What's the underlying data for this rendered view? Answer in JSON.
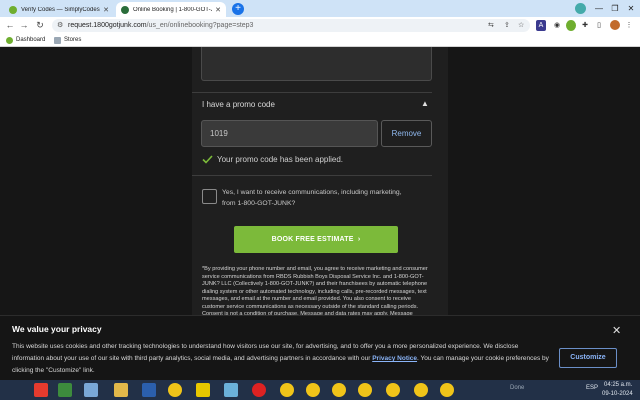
{
  "browser": {
    "tabs": [
      {
        "title": "Verify Codes — SimplyCodes",
        "active": false
      },
      {
        "title": "Online Booking | 1-800-GOT-JUN",
        "active": true
      }
    ],
    "url_host": "request.1800gotjunk.com",
    "url_path": "/us_en/onlinebooking?page=step3",
    "bookmarks": [
      {
        "label": "Dashboard"
      },
      {
        "label": "Stores"
      }
    ],
    "colors": {
      "tabbar": "#cfe3f7",
      "accent": "#1a73e8"
    }
  },
  "form": {
    "promo_heading": "I have a promo code",
    "promo_value": "1019",
    "remove_label": "Remove",
    "applied_message": "Your promo code has been applied.",
    "consent_line1": "Yes, I want to receive communications, including marketing,",
    "consent_line2": "from 1-800-GOT-JUNK?",
    "book_button": "BOOK FREE ESTIMATE",
    "fine_print": "*By providing your phone number and email, you agree to receive marketing and consumer service communications from RBDS Rubbish Boys Disposal Service Inc. and 1-800-GOT-JUNK? LLC (Collectively 1-800-GOT-JUNK?) and their franchisees by automatic telephone dialing system or other automated technology, including calls, pre-recorded messages, text messages, and email at the number and email provided. You also consent to receive customer service communications as necessary outside of the standard calling periods. Consent is not a condition of purchase. Message and data rates may apply. Message",
    "colors": {
      "button": "#7cba3a",
      "link": "#8fb8ee",
      "check": "#7cba3a"
    }
  },
  "cookie": {
    "title": "We value your privacy",
    "text_before": "This website uses cookies and other tracking technologies to understand how visitors use our site, for advertising, and to offer you a more personalized experience. We disclose information about your use of our site with third party analytics, social media, and advertising partners in accordance with our ",
    "link": "Privacy Notice",
    "text_after": ". You can manage your cookie preferences by clicking the \"Customize\" link.",
    "customize_label": "Customize"
  },
  "taskbar": {
    "status_text": "Done",
    "lang": "ESP",
    "time": "04:25 a.m.",
    "date": "09-10-2024"
  }
}
